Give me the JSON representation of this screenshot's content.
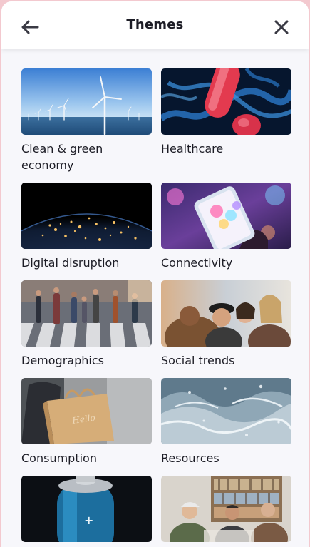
{
  "header": {
    "title": "Themes",
    "back_icon": "arrow-left-icon",
    "close_icon": "close-icon"
  },
  "themes": [
    {
      "label": "Clean & green economy",
      "image": "wind-turbines"
    },
    {
      "label": "Healthcare",
      "image": "bacteria"
    },
    {
      "label": "Digital disruption",
      "image": "earth-at-night"
    },
    {
      "label": "Connectivity",
      "image": "smartphone-lights"
    },
    {
      "label": "Demographics",
      "image": "crowd-crosswalk"
    },
    {
      "label": "Social trends",
      "image": "friends-group"
    },
    {
      "label": "Consumption",
      "image": "shopping-bag"
    },
    {
      "label": "Resources",
      "image": "water-splash"
    },
    {
      "label": "",
      "image": "battery"
    },
    {
      "label": "",
      "image": "people-library"
    }
  ],
  "colors": {
    "background": "#f7f7fb",
    "header": "#ffffff",
    "text": "#1d1d26",
    "frame": "#f3c9cf"
  }
}
